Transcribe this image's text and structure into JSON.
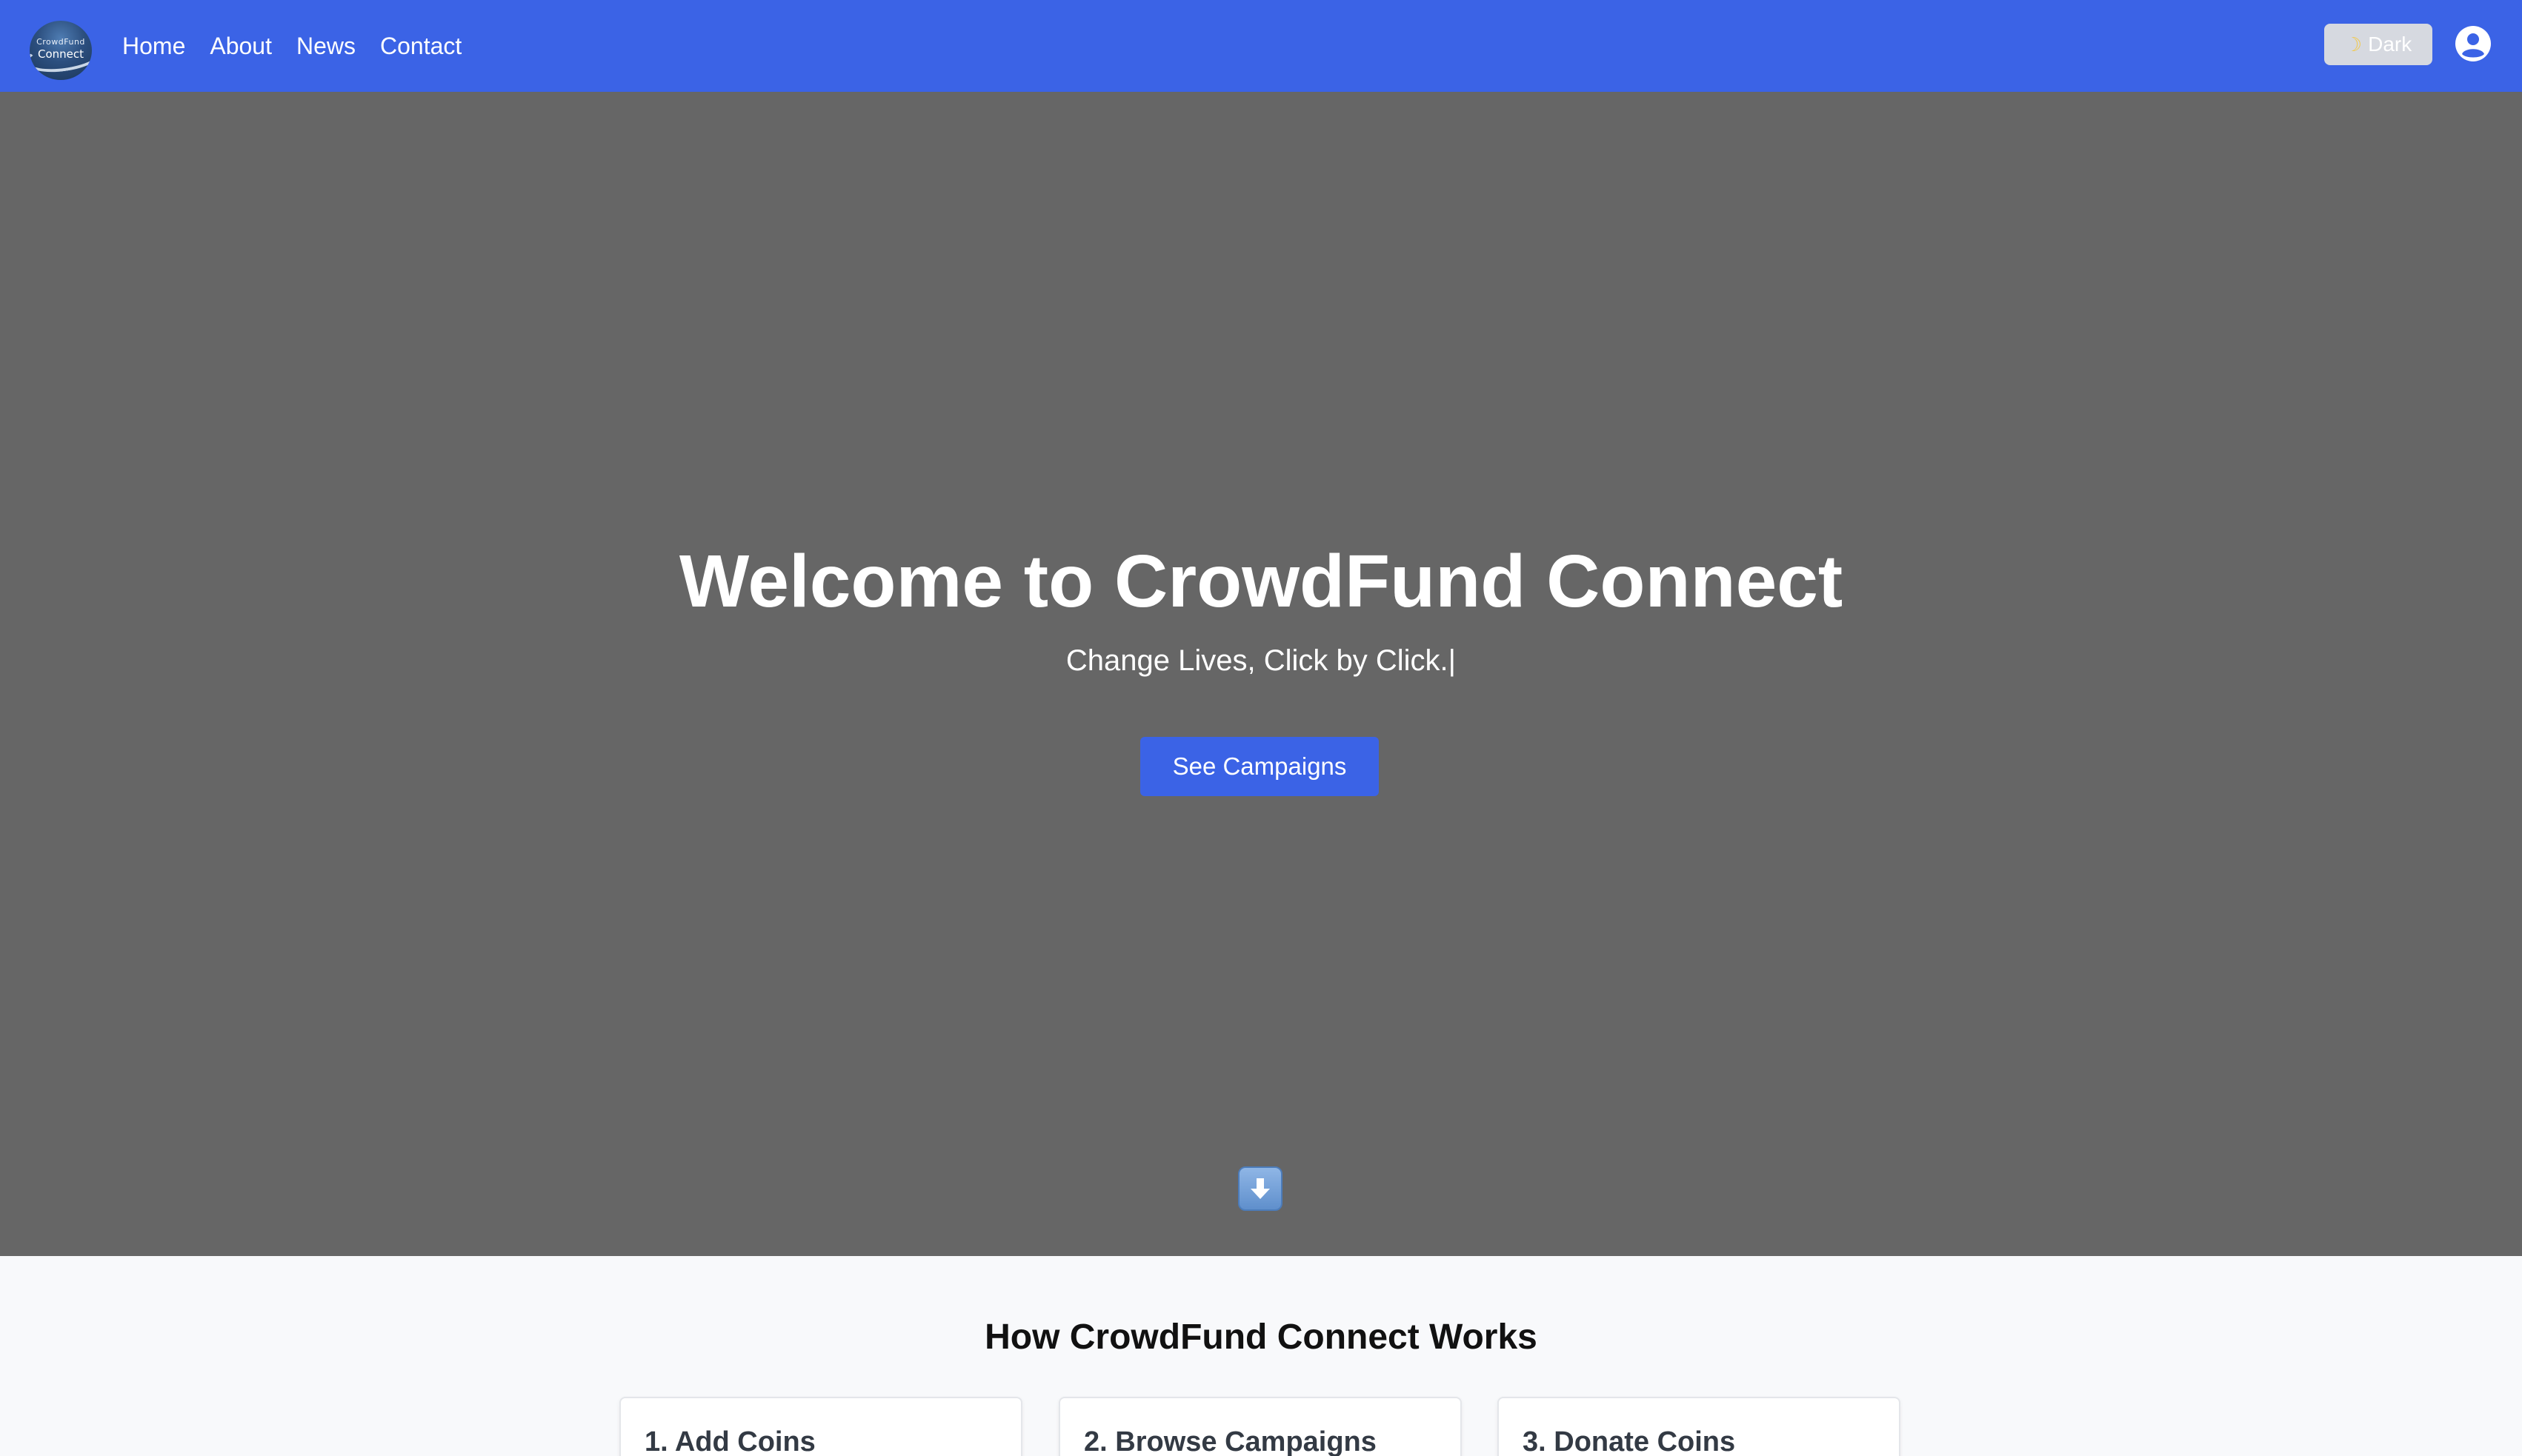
{
  "colors": {
    "brand": "#3b63e6",
    "hero_overlay": "#666666",
    "section_bg": "#f8f9fb"
  },
  "navbar": {
    "logo": {
      "line1": "CrowdFund",
      "line2": "Connect"
    },
    "links": [
      {
        "label": "Home"
      },
      {
        "label": "About"
      },
      {
        "label": "News"
      },
      {
        "label": "Contact"
      }
    ],
    "theme_toggle": {
      "icon": "moon-icon",
      "label": "Dark"
    },
    "user_icon": "user-circle-icon"
  },
  "hero": {
    "title": "Welcome to CrowdFund Connect",
    "subtitle": "Change Lives, Click by Click.|",
    "cta_label": "See Campaigns",
    "scroll_icon": "down-arrow-icon"
  },
  "how_it_works": {
    "title": "How CrowdFund Connect Works",
    "steps": [
      {
        "title": "1. Add Coins"
      },
      {
        "title": "2. Browse Campaigns"
      },
      {
        "title": "3. Donate Coins"
      }
    ]
  }
}
